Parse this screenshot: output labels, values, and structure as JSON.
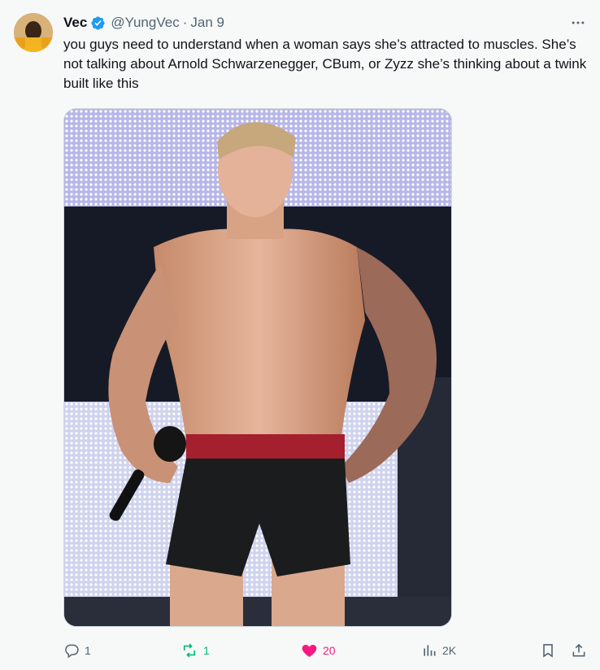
{
  "author": {
    "name": "Vec",
    "handle": "@YungVec",
    "separator": "·",
    "date": "Jan 9",
    "verified": true
  },
  "tweet": {
    "text": "you guys need to understand when a woman says she’s attracted to muscles. She’s not talking about Arnold Schwarzenegger, CBum, or Zyzz she’s thinking about a twink built like this"
  },
  "actions": {
    "reply_count": "1",
    "repost_count": "1",
    "like_count": "20",
    "views_count": "2K"
  },
  "colors": {
    "verified": "#1d9bf0",
    "repost_active": "#00ba7c",
    "like_active": "#f91880",
    "muted": "#536471"
  },
  "icons": [
    "verified-badge-icon",
    "more-icon",
    "reply-icon",
    "repost-icon",
    "heart-icon",
    "views-icon",
    "bookmark-icon",
    "share-icon"
  ]
}
